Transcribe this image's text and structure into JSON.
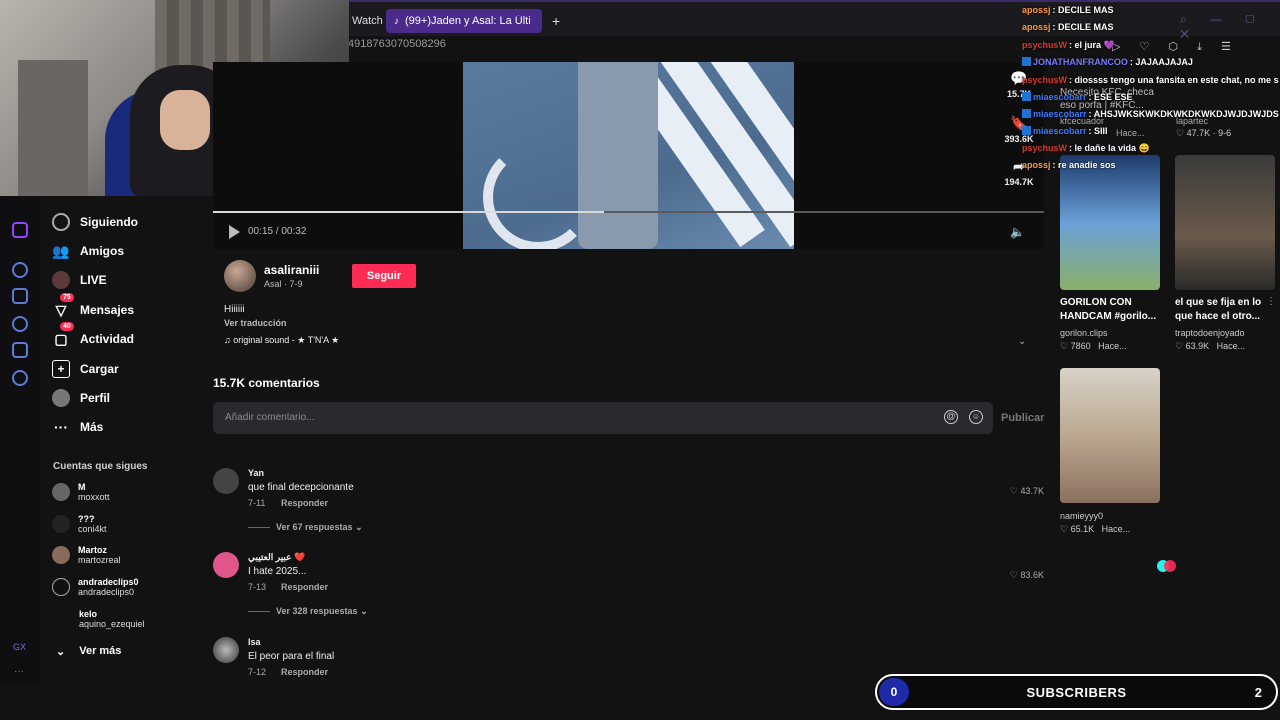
{
  "browser": {
    "tab_prev": "Watch",
    "tab_active": "(99+)Jaden y Asal: La Últi",
    "new_tab": "+",
    "url_fragment": "4918763070508296"
  },
  "nav": {
    "items": [
      {
        "label": "Siguiendo",
        "icon": "following-icon"
      },
      {
        "label": "Amigos",
        "icon": "friends-icon"
      },
      {
        "label": "LIVE",
        "icon": "live-icon"
      },
      {
        "label": "Mensajes",
        "icon": "messages-icon",
        "badge": "75"
      },
      {
        "label": "Actividad",
        "icon": "activity-icon",
        "badge": "40"
      },
      {
        "label": "Cargar",
        "icon": "upload-icon"
      },
      {
        "label": "Perfil",
        "icon": "profile-icon"
      },
      {
        "label": "Más",
        "icon": "more-icon"
      }
    ],
    "following_heading": "Cuentas que sigues",
    "accounts": [
      {
        "name": "M",
        "handle": "moxxott"
      },
      {
        "name": "???",
        "handle": "coni4kt"
      },
      {
        "name": "Martoz",
        "handle": "martozreal"
      },
      {
        "name": "andradeclips0",
        "handle": "andradeclips0"
      },
      {
        "name": "kelo",
        "handle": "aquino_ezequiel"
      }
    ],
    "see_more": "Ver más"
  },
  "video": {
    "time": "00:15 / 00:32",
    "progress": 0.47
  },
  "actions": {
    "comments": "15.7K",
    "saves": "393.6K",
    "shares": "194.7K"
  },
  "author": {
    "name": "asaliraniii",
    "sub": "Asal · 7-9",
    "follow_label": "Seguir",
    "caption": "Hiiiiii",
    "translate": "Ver traducción",
    "sound": "♫ original sound - ★ T'N'A ★"
  },
  "comments": {
    "title": "15.7K comentarios",
    "placeholder": "Añadir comentario...",
    "publish": "Publicar",
    "reply_label": "Responder",
    "items": [
      {
        "user": "Yan",
        "text": "que final decepcionante",
        "date": "7-11",
        "likes": "43.7K",
        "replies": "Ver 67 respuestas"
      },
      {
        "user": "عبير العتيبي ❤️",
        "text": "I hate 2025...",
        "date": "7-13",
        "likes": "83.6K",
        "replies": "Ver 328 respuestas"
      },
      {
        "user": "Isa",
        "text": "El peor para el final",
        "date": "7-12",
        "likes": "",
        "replies": ""
      }
    ]
  },
  "recommendations": [
    {
      "title": "GORILON CON HANDCAM #gorilo...",
      "author": "gorilon.clips",
      "likes": "♡ 7860",
      "time": "Hace..."
    },
    {
      "title": "el que se fija en lo que hace el otro...",
      "author": "traptodoenjoyado",
      "likes": "♡ 63.9K",
      "time": "Hace..."
    },
    {
      "title": "",
      "author": "namieyyy0",
      "likes": "♡ 65.1K",
      "time": "Hace..."
    }
  ],
  "rec_top": {
    "title_partial": "Necesito KFC, checa eso porfa | #KFC...",
    "author": "kfcecuador",
    "time": "Hace...",
    "meta_right": "♡ 47.7K · 9-6",
    "author_right": "lapartec"
  },
  "chat": [
    {
      "user": "apossj",
      "msg": ": DECILE MAS",
      "color": "#ff9a3c"
    },
    {
      "user": "apossj",
      "msg": ": DECILE MAS",
      "color": "#ff9a3c"
    },
    {
      "user": "psychusW",
      "msg": ": el jura 💜",
      "color": "#d9382b"
    },
    {
      "user": "JONATHANFRANCOO",
      "msg": ": JAJAAJAJAJ",
      "color": "#7a7aff",
      "prime": true
    },
    {
      "user": "psychusW",
      "msg": ": diossss tengo una fansita en este chat, no me s",
      "color": "#d9382b"
    },
    {
      "user": "miaescobarr",
      "msg": ": ESE ESE",
      "color": "#3b7bff",
      "prime": true
    },
    {
      "user": "miaescobarr",
      "msg": ": AHSJWKSKWKDKWKDKWKDJWJDJWJDS",
      "color": "#3b7bff",
      "prime": true
    },
    {
      "user": "miaescobarr",
      "msg": ": SIII",
      "color": "#3b7bff",
      "prime": true
    },
    {
      "user": "psychusW",
      "msg": ": le dañe la vida 😄",
      "color": "#d9382b"
    },
    {
      "user": "apossj",
      "msg": ": re anadie sos",
      "color": "#ff9a3c"
    }
  ],
  "subs_bar": {
    "count": "0",
    "label": "SUBSCRIBERS",
    "goal": "2"
  },
  "colors": {
    "accent": "#fe2c55",
    "tab_active": "#4a2a8a",
    "background": "#121212"
  }
}
